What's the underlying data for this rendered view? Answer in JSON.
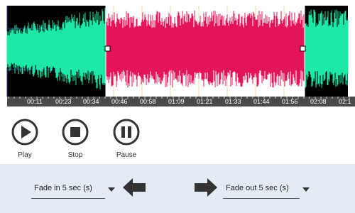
{
  "timeline": {
    "ticks": [
      "00:11",
      "00:23",
      "00:34",
      "00:46",
      "00:58",
      "01:09",
      "01:21",
      "01:33",
      "01:44",
      "01:56",
      "02:08",
      "02:1"
    ]
  },
  "controls": {
    "play_label": "Play",
    "stop_label": "Stop",
    "pause_label": "Pause"
  },
  "fade": {
    "fade_in_value": "Fade in 5 sec (s)",
    "fade_out_value": "Fade out 5 sec (s)"
  },
  "colors": {
    "unselected_wave": "#1ee8a8",
    "selected_wave": "#e4145c",
    "background_dark": "#000000"
  }
}
